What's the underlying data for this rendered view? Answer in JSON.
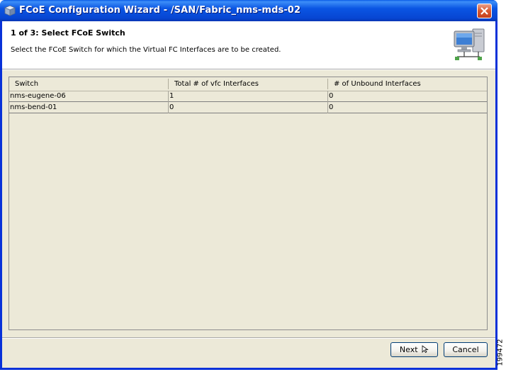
{
  "window": {
    "title": "FCoE Configuration Wizard - /SAN/Fabric_nms-mds-02"
  },
  "header": {
    "step_title": "1 of 3: Select FCoE Switch",
    "description": "Select the FCoE Switch for which the Virtual FC Interfaces are to be created."
  },
  "table": {
    "columns": [
      "Switch",
      "Total # of vfc Interfaces",
      "# of Unbound Interfaces"
    ],
    "rows": [
      [
        "nms-eugene-06",
        "1",
        "0"
      ],
      [
        "nms-bend-01",
        "0",
        "0"
      ]
    ]
  },
  "footer": {
    "next_label": "Next",
    "cancel_label": "Cancel"
  },
  "figure_number": "199472",
  "icons": {
    "title": "wizard-app-icon",
    "header": "computer-network-icon",
    "close": "close-icon",
    "next": "cursor-icon"
  },
  "colors": {
    "titlebar": "#0a55e3",
    "client": "#ece9d8",
    "close_button": "#d8582f"
  }
}
